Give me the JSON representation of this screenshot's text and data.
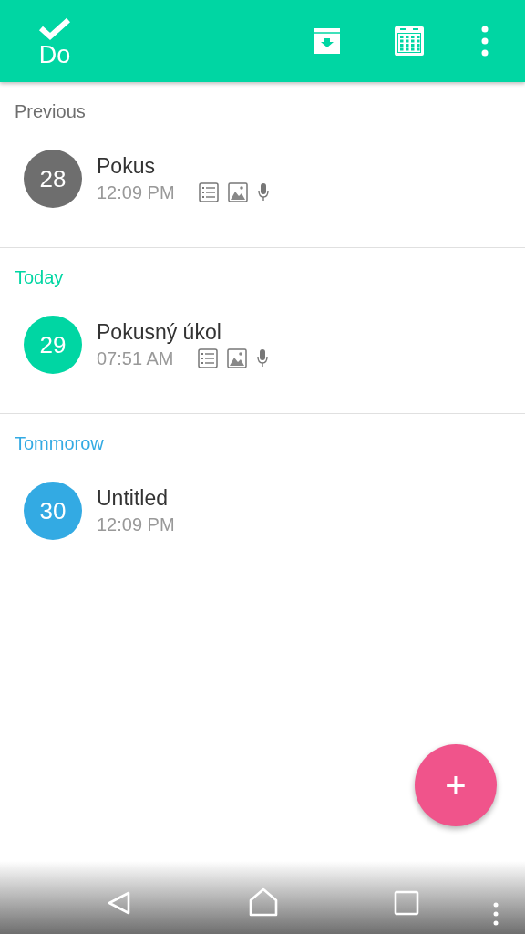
{
  "app_bar": {
    "logo_text": "Do"
  },
  "sections": [
    {
      "title": "Previous",
      "color": "#6e6e6e",
      "tasks": [
        {
          "day": "28",
          "title": "Pokus",
          "time": "12:09 PM",
          "attachments": [
            {
              "kind": "list"
            },
            {
              "kind": "image"
            },
            {
              "kind": "audio"
            }
          ]
        }
      ]
    },
    {
      "title": "Today",
      "color": "#00d6a3",
      "tasks": [
        {
          "day": "29",
          "title": "Pokusný úkol",
          "time": "07:51 AM",
          "attachments": [
            {
              "kind": "list"
            },
            {
              "kind": "image"
            },
            {
              "kind": "audio"
            }
          ]
        }
      ]
    },
    {
      "title": "Tommorow",
      "color": "#33aae3",
      "tasks": [
        {
          "day": "30",
          "title": "Untitled",
          "time": "12:09 PM"
        }
      ]
    }
  ],
  "fab": {
    "label": "+"
  }
}
